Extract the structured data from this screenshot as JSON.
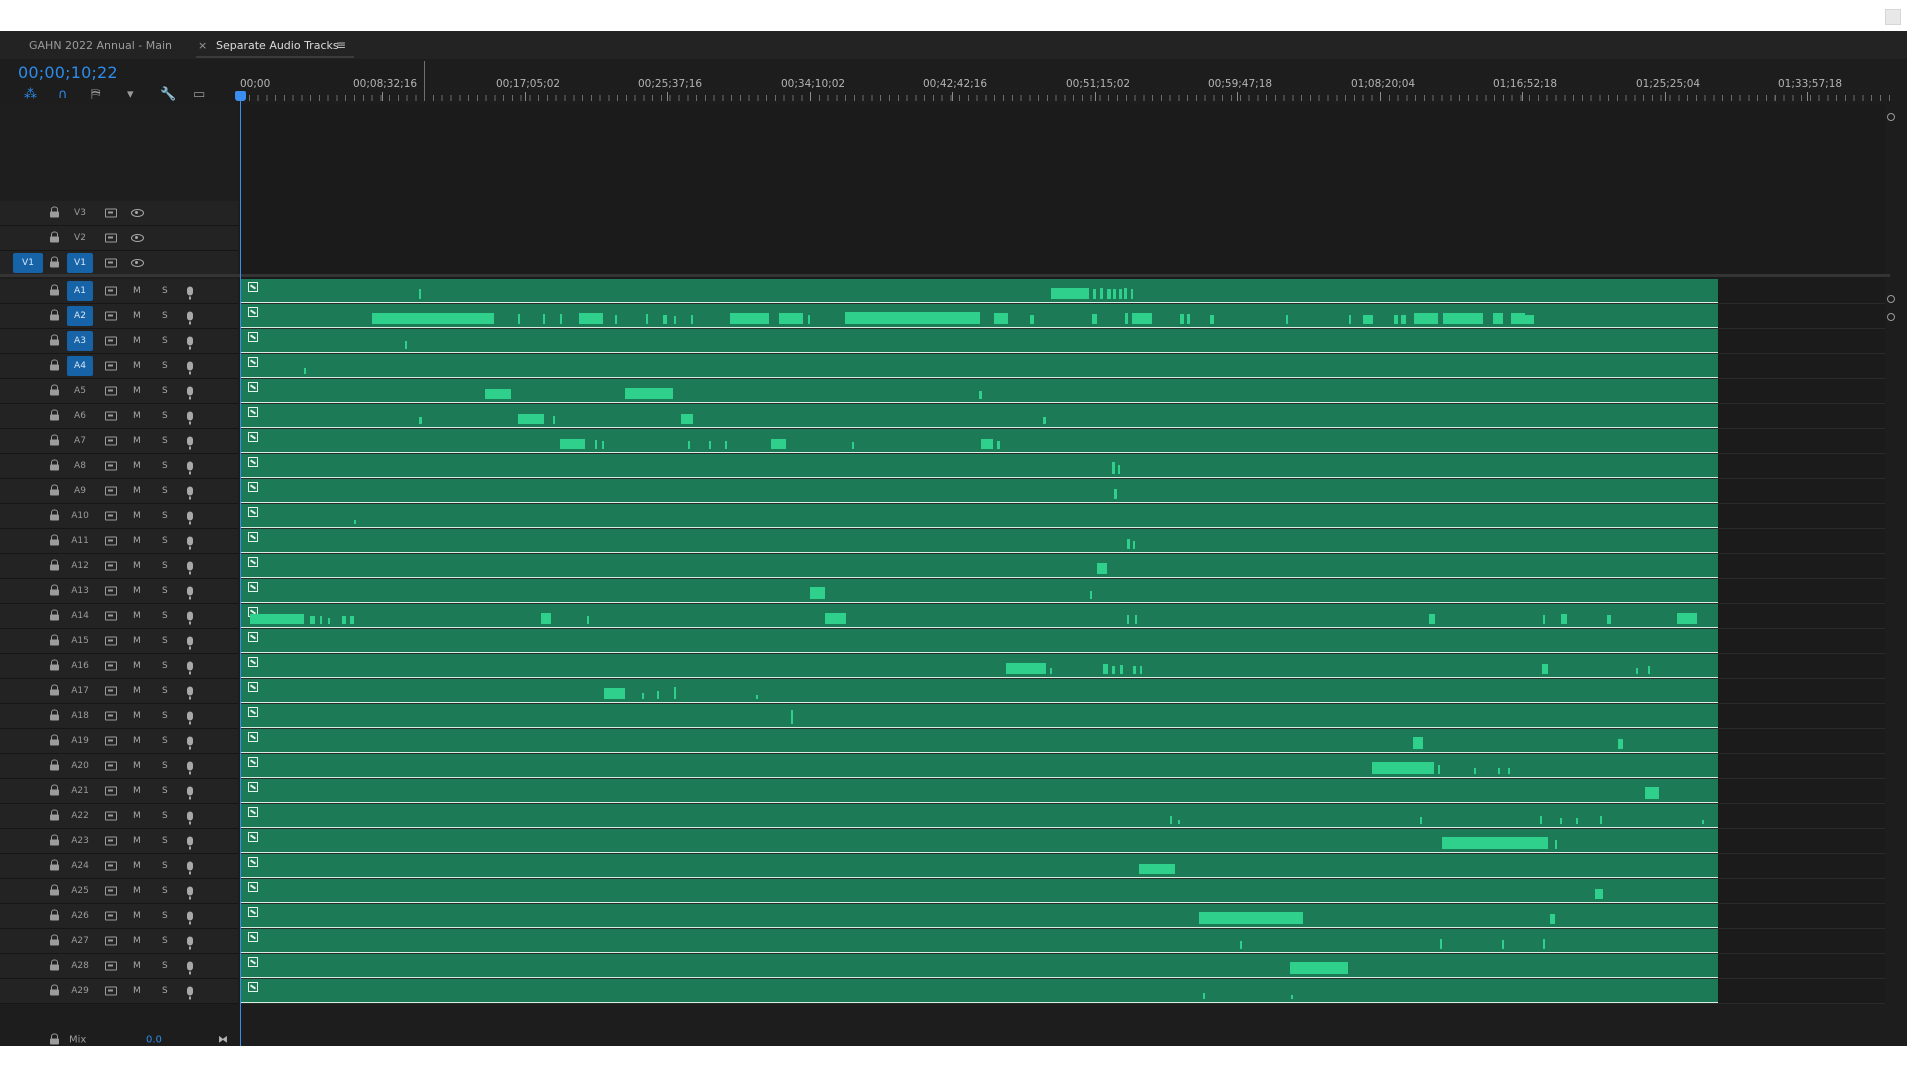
{
  "tabs": [
    {
      "label": "GAHN 2022 Annual - Main",
      "active": false
    },
    {
      "label": "Separate Audio Tracks",
      "active": true
    }
  ],
  "timecode": "00;00;10;22",
  "ruler_labels": [
    "00;00",
    "00;08;32;16",
    "00;17;05;02",
    "00;25;37;16",
    "00;34;10;02",
    "00;42;42;16",
    "00;51;15;02",
    "00;59;47;18",
    "01;08;20;04",
    "01;16;52;18",
    "01;25;25;04",
    "01;33;57;18"
  ],
  "toolbar_icons": [
    "snap-in-timeline-icon",
    "linked-selection-icon",
    "add-marker-icon",
    "marker-icon",
    "wrench-icon",
    "captions-icon"
  ],
  "video_tracks": [
    {
      "name": "V3",
      "source": "",
      "targeted": false
    },
    {
      "name": "V2",
      "source": "",
      "targeted": false
    },
    {
      "name": "V1",
      "source": "V1",
      "targeted": true
    }
  ],
  "audio_tracks": [
    {
      "name": "A1",
      "targeted": true,
      "m": "M",
      "s": "S"
    },
    {
      "name": "A2",
      "targeted": true,
      "m": "M",
      "s": "S"
    },
    {
      "name": "A3",
      "targeted": true,
      "m": "M",
      "s": "S"
    },
    {
      "name": "A4",
      "targeted": true,
      "m": "M",
      "s": "S"
    },
    {
      "name": "A5",
      "targeted": false,
      "m": "M",
      "s": "S"
    },
    {
      "name": "A6",
      "targeted": false,
      "m": "M",
      "s": "S"
    },
    {
      "name": "A7",
      "targeted": false,
      "m": "M",
      "s": "S"
    },
    {
      "name": "A8",
      "targeted": false,
      "m": "M",
      "s": "S"
    },
    {
      "name": "A9",
      "targeted": false,
      "m": "M",
      "s": "S"
    },
    {
      "name": "A10",
      "targeted": false,
      "m": "M",
      "s": "S"
    },
    {
      "name": "A11",
      "targeted": false,
      "m": "M",
      "s": "S"
    },
    {
      "name": "A12",
      "targeted": false,
      "m": "M",
      "s": "S"
    },
    {
      "name": "A13",
      "targeted": false,
      "m": "M",
      "s": "S"
    },
    {
      "name": "A14",
      "targeted": false,
      "m": "M",
      "s": "S"
    },
    {
      "name": "A15",
      "targeted": false,
      "m": "M",
      "s": "S"
    },
    {
      "name": "A16",
      "targeted": false,
      "m": "M",
      "s": "S"
    },
    {
      "name": "A17",
      "targeted": false,
      "m": "M",
      "s": "S"
    },
    {
      "name": "A18",
      "targeted": false,
      "m": "M",
      "s": "S"
    },
    {
      "name": "A19",
      "targeted": false,
      "m": "M",
      "s": "S"
    },
    {
      "name": "A20",
      "targeted": false,
      "m": "M",
      "s": "S"
    },
    {
      "name": "A21",
      "targeted": false,
      "m": "M",
      "s": "S"
    },
    {
      "name": "A22",
      "targeted": false,
      "m": "M",
      "s": "S"
    },
    {
      "name": "A23",
      "targeted": false,
      "m": "M",
      "s": "S"
    },
    {
      "name": "A24",
      "targeted": false,
      "m": "M",
      "s": "S"
    },
    {
      "name": "A25",
      "targeted": false,
      "m": "M",
      "s": "S"
    },
    {
      "name": "A26",
      "targeted": false,
      "m": "M",
      "s": "S"
    },
    {
      "name": "A27",
      "targeted": false,
      "m": "M",
      "s": "S"
    },
    {
      "name": "A28",
      "targeted": false,
      "m": "M",
      "s": "S"
    },
    {
      "name": "A29",
      "targeted": false,
      "m": "M",
      "s": "S"
    }
  ],
  "mix": {
    "label": "Mix",
    "value": "0.0"
  },
  "colors": {
    "accent": "#2d8ceb",
    "clip_fill": "#1c7a57",
    "waveform": "#2fd08c",
    "panel_bg": "#1d1d1d",
    "track_target": "#1663a8"
  }
}
